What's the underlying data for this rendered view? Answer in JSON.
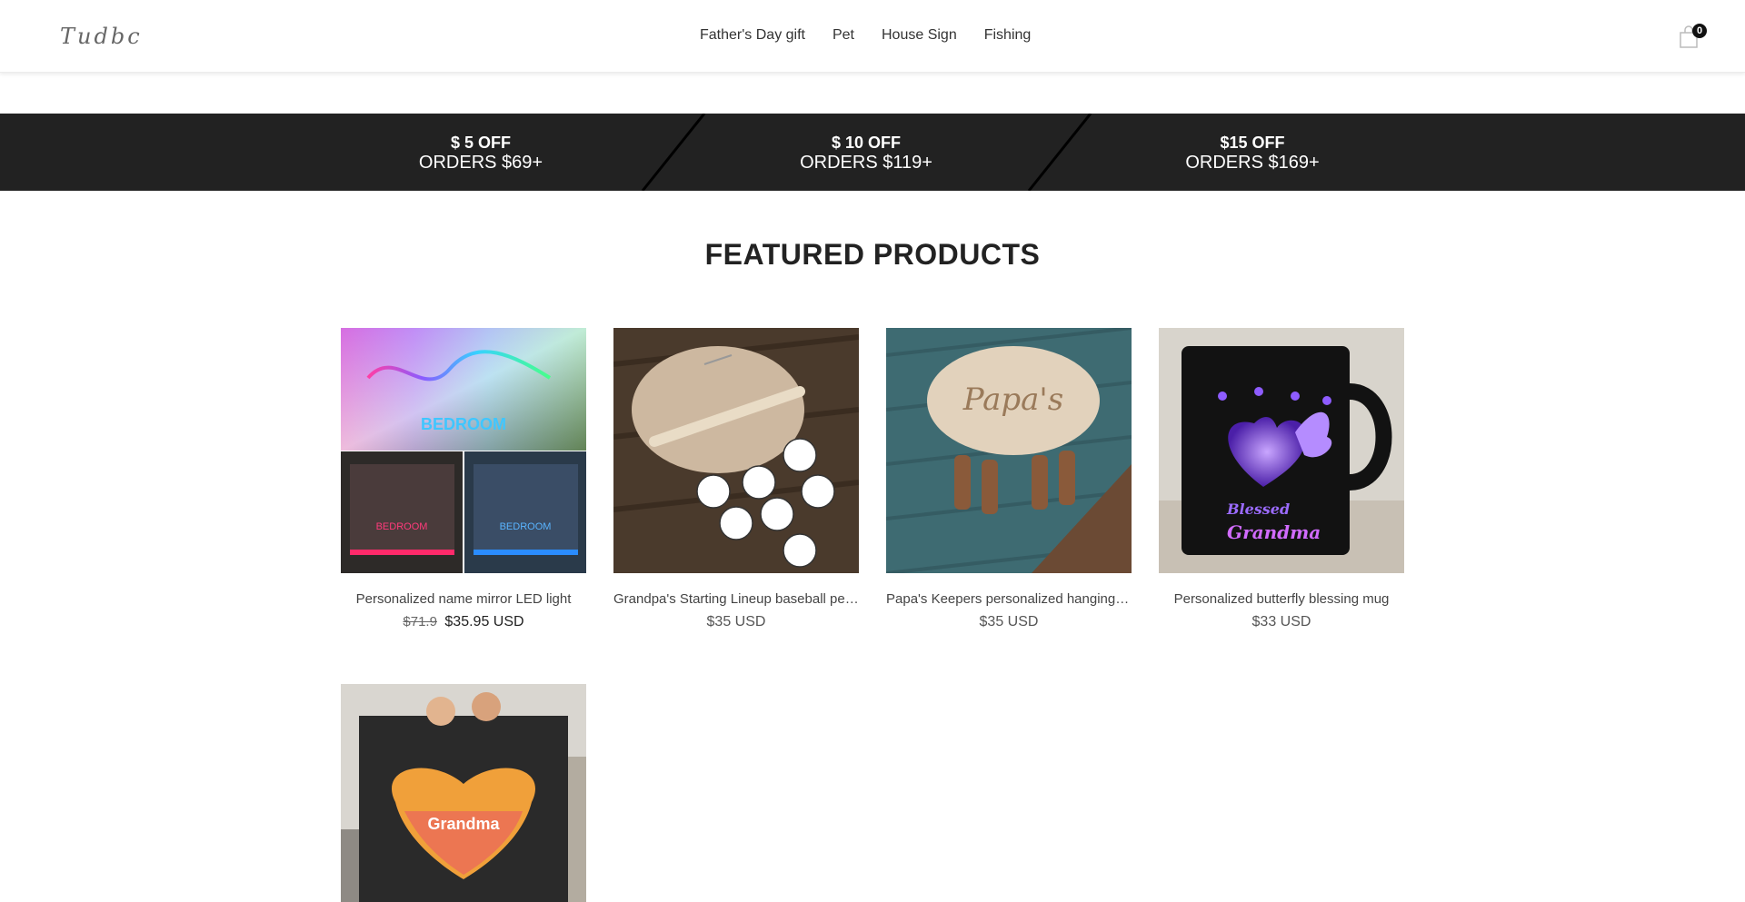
{
  "header": {
    "logo_text": "Tudbc",
    "nav": [
      "Father's Day gift",
      "Pet",
      "House Sign",
      "Fishing"
    ],
    "cart_count": "0",
    "cart_icon": "shopping-bag-icon"
  },
  "promo": [
    {
      "amount": "$ 5 OFF",
      "orders": "ORDERS $69+"
    },
    {
      "amount": "$ 10 OFF",
      "orders": "ORDERS $119+"
    },
    {
      "amount": "$15 OFF",
      "orders": "ORDERS $169+"
    }
  ],
  "featured": {
    "title": "FEATURED PRODUCTS",
    "products": [
      {
        "title": "Personalized name mirror LED light",
        "old_price": "$71.9",
        "price": "$35.95 USD"
      },
      {
        "title": "Grandpa's Starting Lineup baseball personalized sign",
        "old_price": "",
        "price": "$35 USD"
      },
      {
        "title": "Papa's Keepers personalized hanging sign",
        "old_price": "",
        "price": "$35 USD"
      },
      {
        "title": "Personalized butterfly blessing mug",
        "old_price": "",
        "price": "$33 USD"
      },
      {
        "title": "",
        "old_price": "",
        "price": ""
      }
    ]
  },
  "colors": {
    "promo_bg": "#222222",
    "text_dark": "#222222",
    "accent_purple": "#6a2fd6"
  }
}
